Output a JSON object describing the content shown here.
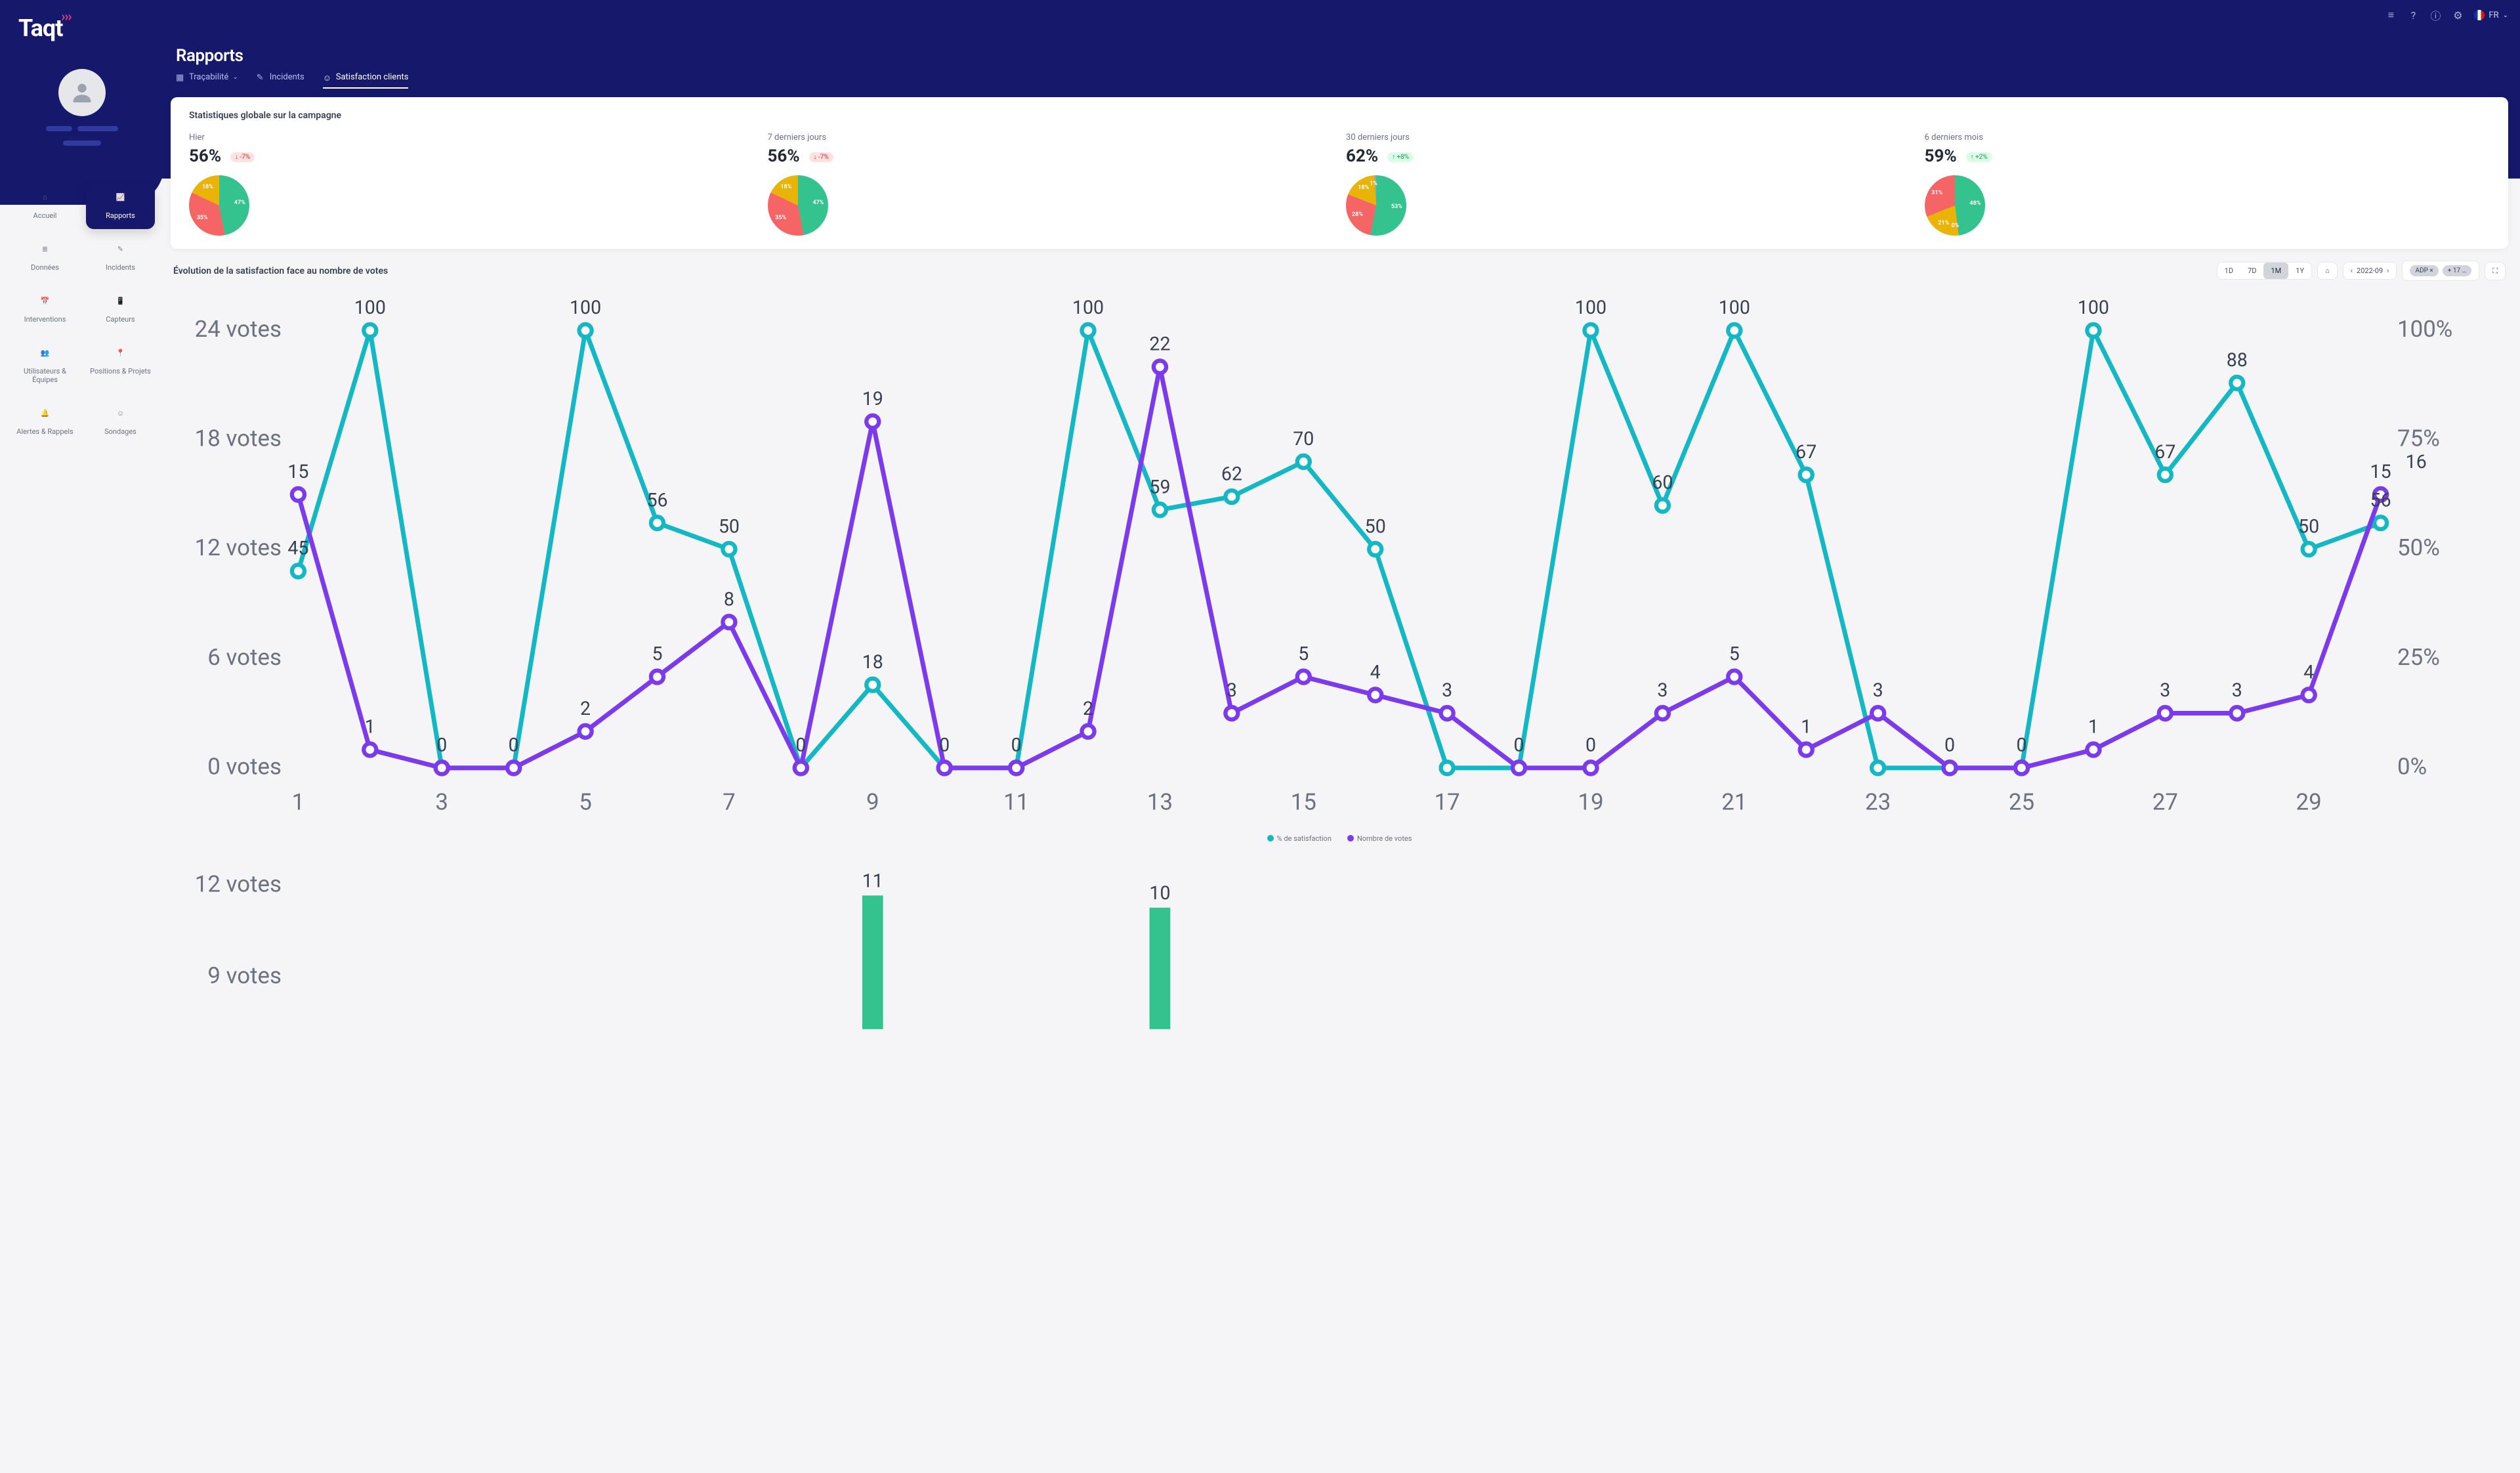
{
  "brand": "Taqt",
  "top": {
    "lang": "FR"
  },
  "page_title": "Rapports",
  "tabs": [
    {
      "label": "Traçabilité",
      "active": false,
      "caret": true
    },
    {
      "label": "Incidents",
      "active": false
    },
    {
      "label": "Satisfaction clients",
      "active": true
    }
  ],
  "nav": [
    {
      "label": "Accueil"
    },
    {
      "label": "Rapports",
      "active": true
    },
    {
      "label": "Données"
    },
    {
      "label": "Incidents"
    },
    {
      "label": "Interventions"
    },
    {
      "label": "Capteurs"
    },
    {
      "label": "Utilisateurs & Équipes"
    },
    {
      "label": "Positions & Projets"
    },
    {
      "label": "Alertes & Rappels"
    },
    {
      "label": "Sondages"
    }
  ],
  "stats_title": "Statistiques globale sur la campagne",
  "stats": [
    {
      "label": "Hier",
      "value": "56%",
      "trend_dir": "down",
      "trend": "-7%",
      "slices": [
        {
          "v": 47,
          "c": "#34c38f"
        },
        {
          "v": 35,
          "c": "#f56565"
        },
        {
          "v": 18,
          "c": "#eab308"
        }
      ]
    },
    {
      "label": "7 derniers jours",
      "value": "56%",
      "trend_dir": "down",
      "trend": "-7%",
      "slices": [
        {
          "v": 47,
          "c": "#34c38f"
        },
        {
          "v": 35,
          "c": "#f56565"
        },
        {
          "v": 18,
          "c": "#eab308"
        }
      ]
    },
    {
      "label": "30 derniers jours",
      "value": "62%",
      "trend_dir": "up",
      "trend": "+8%",
      "slices": [
        {
          "v": 53,
          "c": "#34c38f"
        },
        {
          "v": 28,
          "c": "#f56565"
        },
        {
          "v": 18,
          "c": "#eab308"
        },
        {
          "v": 1,
          "c": "#94a3b8"
        }
      ]
    },
    {
      "label": "6 derniers mois",
      "value": "59%",
      "trend_dir": "up",
      "trend": "+2%",
      "slices": [
        {
          "v": 48,
          "c": "#34c38f"
        },
        {
          "v": 0,
          "c": "#94a3b8"
        },
        {
          "v": 21,
          "c": "#eab308"
        },
        {
          "v": 31,
          "c": "#f56565"
        }
      ]
    }
  ],
  "chart_title": "Évolution de la satisfaction face au nombre de votes",
  "period": {
    "options": [
      "1D",
      "7D",
      "1M",
      "1Y"
    ],
    "active": "1M",
    "month": "2022-09",
    "filter_chip": "ADP",
    "extra_chip": "+ 17 …"
  },
  "legend": {
    "sat": "% de satisfaction",
    "votes": "Nombre de votes"
  },
  "bar_yticks": [
    "12 votes",
    "9 votes"
  ],
  "chart_data": {
    "type": "line",
    "title": "Évolution de la satisfaction face au nombre de votes",
    "x": [
      1,
      2,
      3,
      4,
      5,
      6,
      7,
      8,
      9,
      10,
      11,
      12,
      13,
      14,
      15,
      16,
      17,
      18,
      19,
      20,
      21,
      22,
      23,
      24,
      25,
      26,
      27,
      28,
      29,
      30
    ],
    "x_ticks": [
      1,
      3,
      5,
      7,
      9,
      11,
      13,
      15,
      17,
      19,
      21,
      23,
      25,
      27,
      29
    ],
    "y_left": {
      "label": "votes",
      "ticks": [
        0,
        6,
        12,
        18,
        24
      ]
    },
    "y_right": {
      "label": "%",
      "ticks": [
        0,
        25,
        50,
        75,
        100
      ]
    },
    "series": [
      {
        "name": "% de satisfaction",
        "axis": "right",
        "color": "#14b8c4",
        "values": [
          45,
          100,
          0,
          0,
          100,
          56,
          50,
          0,
          19,
          0,
          0,
          100,
          59,
          62,
          70,
          50,
          0,
          0,
          100,
          60,
          100,
          67,
          0,
          0,
          0,
          100,
          67,
          88,
          50,
          56
        ]
      },
      {
        "name": "Nombre de votes",
        "axis": "left",
        "color": "#7c3aed",
        "values": [
          15,
          1,
          0,
          0,
          2,
          5,
          8,
          0,
          19,
          0,
          0,
          2,
          22,
          3,
          5,
          4,
          3,
          0,
          0,
          3,
          5,
          1,
          3,
          0,
          0,
          1,
          3,
          3,
          4,
          15
        ]
      }
    ],
    "point_labels": {
      "sat": {
        "1": "45",
        "2": "100",
        "5": "100",
        "6": "56",
        "7": "50",
        "9": "18",
        "12": "100",
        "13": "59",
        "14": "62",
        "15": "70",
        "16": "50",
        "19": "100",
        "20": "60",
        "21": "100",
        "22": "67",
        "26": "100",
        "27": "67",
        "28": "88",
        "29": "50",
        "30": "56"
      },
      "votes": {
        "1": "15",
        "2": "1",
        "3": "0",
        "4": "0",
        "5": "2",
        "6": "5",
        "7": "8",
        "8": "0",
        "9": "19",
        "10": "0",
        "11": "0",
        "12": "2",
        "13": "22",
        "14": "3",
        "15": "5",
        "16": "4",
        "17": "3",
        "18": "0",
        "19": "0",
        "20": "3",
        "21": "5",
        "22": "1",
        "23": "3",
        "24": "0",
        "25": "0",
        "26": "1",
        "27": "3",
        "28": "3",
        "29": "4",
        "30": "15",
        "30b": "16"
      }
    },
    "bar_below": {
      "type": "bar",
      "peaks": {
        "9": 11,
        "13": 10
      }
    }
  }
}
